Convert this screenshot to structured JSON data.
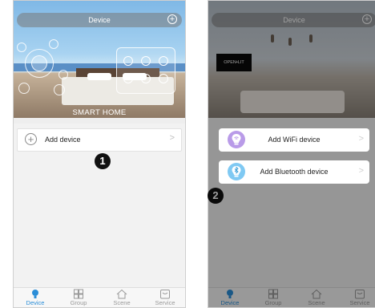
{
  "phone1": {
    "title": "Device",
    "hero_text": "SMART HOME",
    "add_device_label": "Add device",
    "badge": "1",
    "tabs": [
      {
        "label": "Device",
        "icon": "bulb-icon",
        "active": true
      },
      {
        "label": "Group",
        "icon": "group-icon",
        "active": false
      },
      {
        "label": "Scene",
        "icon": "home-icon",
        "active": false
      },
      {
        "label": "Service",
        "icon": "service-icon",
        "active": false
      }
    ]
  },
  "phone2": {
    "title": "Device",
    "painting_text": "OPEN•LIT",
    "options": [
      {
        "label": "Add WiFi device",
        "icon": "wifi-bulb-icon"
      },
      {
        "label": "Add Bluetooth device",
        "icon": "bluetooth-bulb-icon"
      }
    ],
    "badge": "2",
    "tabs": [
      {
        "label": "Device",
        "icon": "bulb-icon",
        "active": true
      },
      {
        "label": "Group",
        "icon": "group-icon",
        "active": false
      },
      {
        "label": "Scene",
        "icon": "home-icon",
        "active": false
      },
      {
        "label": "Service",
        "icon": "service-icon",
        "active": false
      }
    ]
  },
  "colors": {
    "accent": "#2b8ed8",
    "wifi_icon_bg": "#b99be8",
    "bt_icon_bg": "#7fc9f3"
  }
}
